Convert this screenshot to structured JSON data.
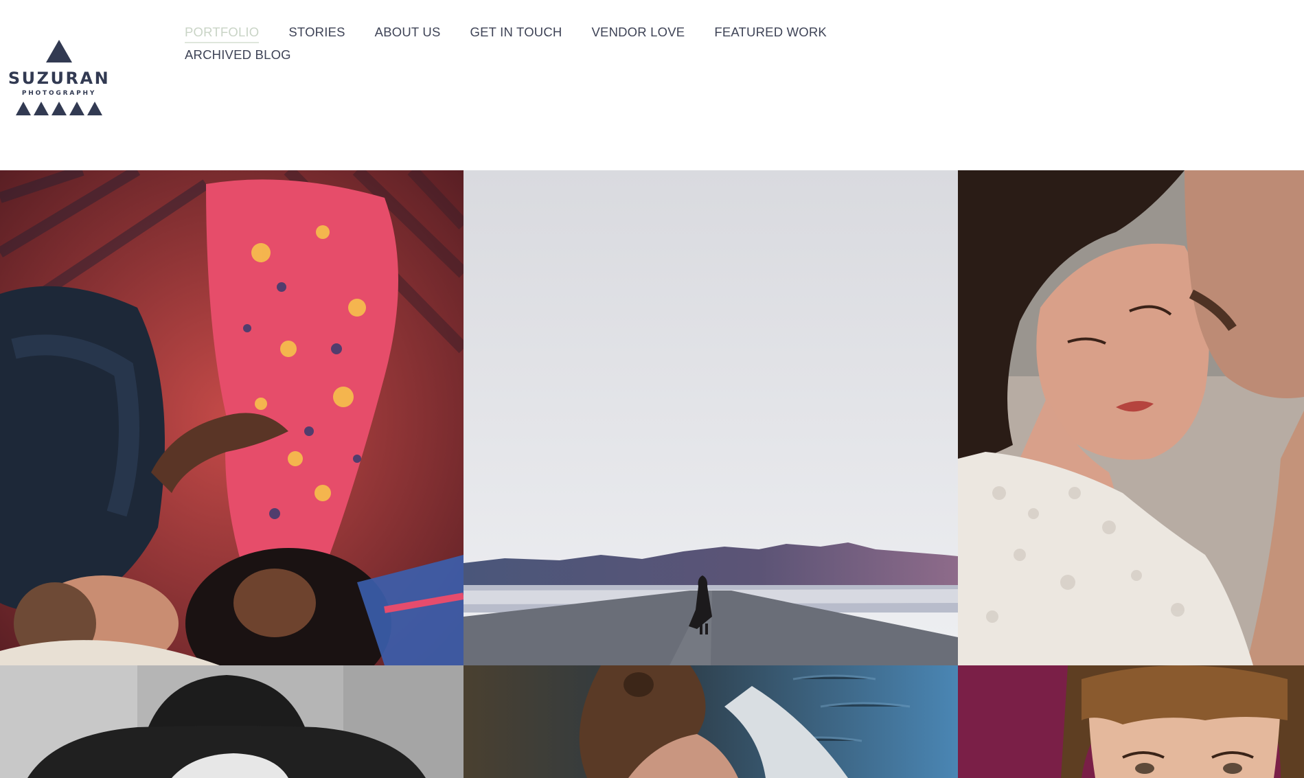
{
  "site": {
    "logo": {
      "name": "SUZURAN",
      "tagline": "PHOTOGRAPHY",
      "color": "#323a52"
    }
  },
  "nav": {
    "items": [
      {
        "label": "PORTFOLIO",
        "active": true
      },
      {
        "label": "STORIES",
        "active": false
      },
      {
        "label": "ABOUT US",
        "active": false
      },
      {
        "label": "GET IN TOUCH",
        "active": false
      },
      {
        "label": "VENDOR LOVE",
        "active": false
      },
      {
        "label": "FEATURED WORK",
        "active": false
      },
      {
        "label": "ARCHIVED BLOG",
        "active": false
      }
    ],
    "active_color": "#c9d4c6",
    "text_color": "#3e4356"
  },
  "gallery": {
    "photos": [
      {
        "icon": "photo-couple-embrace-on-rug"
      },
      {
        "icon": "photo-figure-on-desert-road"
      },
      {
        "icon": "photo-bride-kissed-on-cheek"
      },
      {
        "icon": "photo-woman-in-black-hat"
      },
      {
        "icon": "photo-woman-in-boat"
      },
      {
        "icon": "photo-woman-with-bangs"
      }
    ]
  }
}
